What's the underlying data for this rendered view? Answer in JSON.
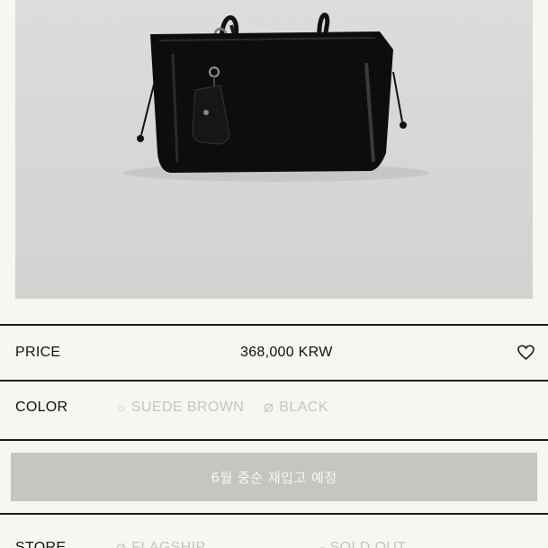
{
  "product": {
    "image_alt": "black leather tote bag",
    "price_label": "PRICE",
    "price_value": "368,000 KRW",
    "color_label": "COLOR",
    "colors": [
      {
        "symbol": "○",
        "name": "SUEDE BROWN"
      },
      {
        "symbol": "Ø",
        "name": "BLACK"
      }
    ],
    "restock_button": "6월 중순 재입고 예정",
    "store_label": "STORE",
    "store_option": {
      "symbol": "Ø",
      "name": "FLAGSHIP"
    },
    "store_status": "-  SOLD OUT"
  },
  "icons": {
    "wishlist": "heart-icon"
  },
  "colors_ui": {
    "background": "#f8f6f1",
    "divider": "#1d1d1d",
    "disabled_text": "#c6c4bf",
    "button_bg": "#c6c6c0"
  }
}
